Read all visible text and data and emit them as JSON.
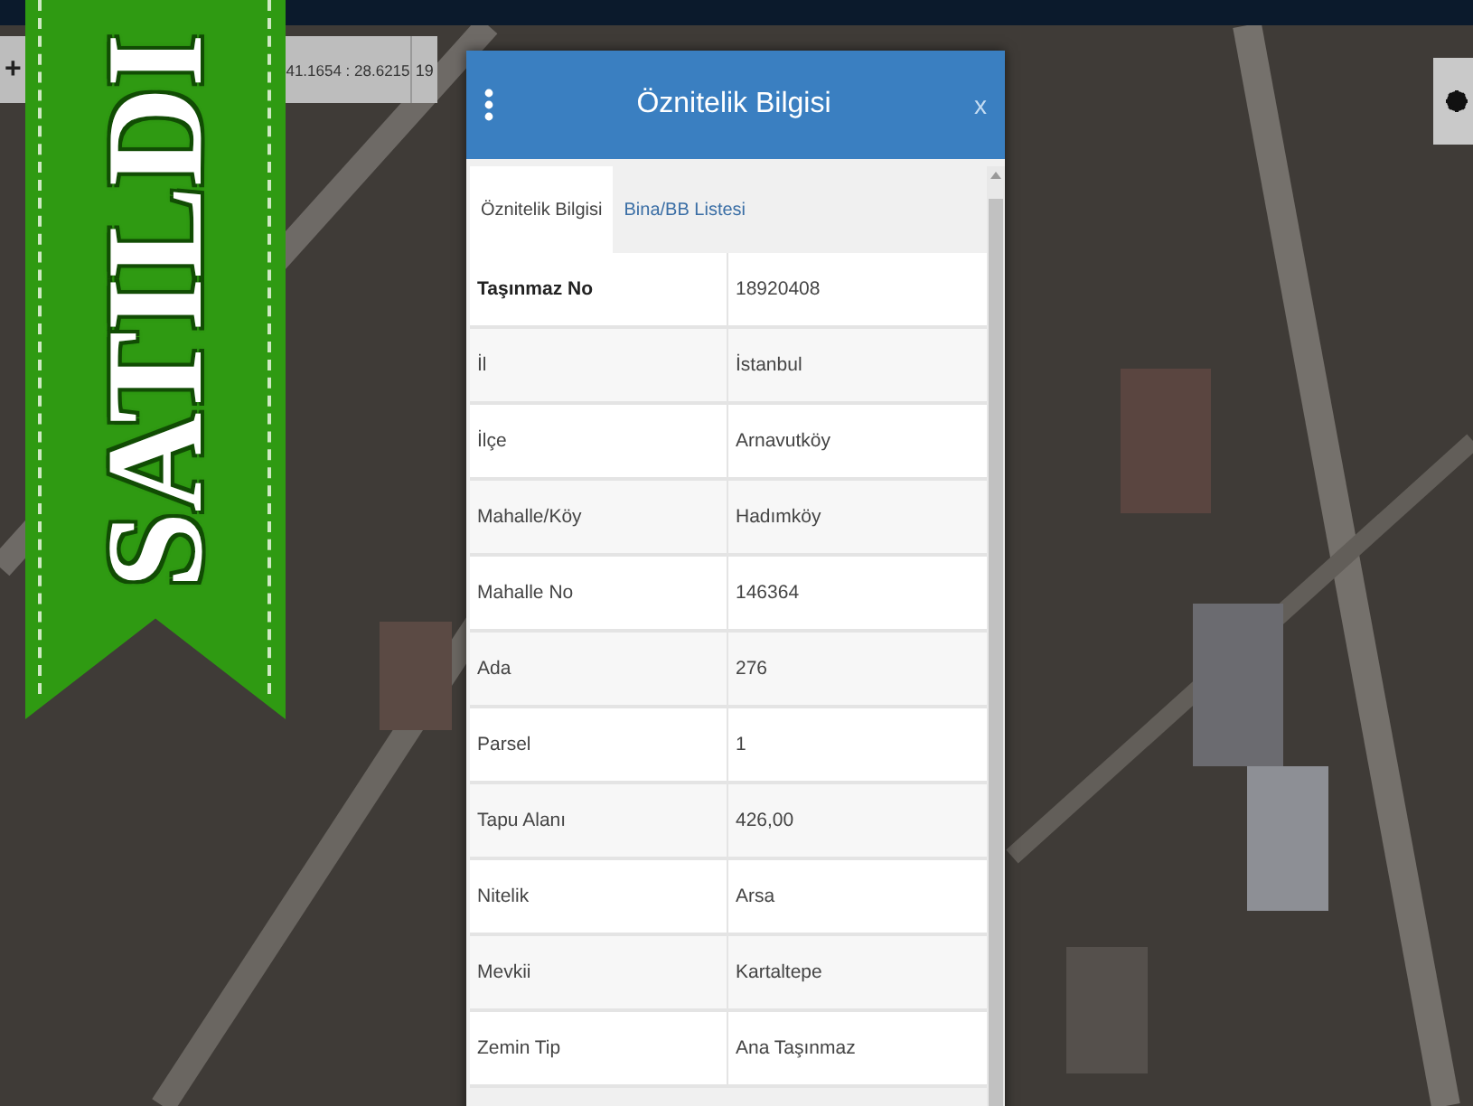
{
  "toolbar": {
    "zoom_in": "+",
    "coordinates": "41.1654 : 28.6215",
    "zoom_level": "19"
  },
  "sold_banner": {
    "text": "SATILDI"
  },
  "dialog": {
    "title": "Öznitelik Bilgisi",
    "close": "x",
    "tabs": [
      {
        "label": "Öznitelik Bilgisi",
        "selected": true
      },
      {
        "label": "Bina/BB Listesi",
        "selected": false
      }
    ],
    "rows": [
      {
        "label": "Taşınmaz No",
        "value": "18920408"
      },
      {
        "label": "İl",
        "value": "İstanbul"
      },
      {
        "label": "İlçe",
        "value": "Arnavutköy"
      },
      {
        "label": "Mahalle/Köy",
        "value": "Hadımköy"
      },
      {
        "label": "Mahalle No",
        "value": "146364"
      },
      {
        "label": "Ada",
        "value": "276"
      },
      {
        "label": "Parsel",
        "value": "1"
      },
      {
        "label": "Tapu Alanı",
        "value": "426,00"
      },
      {
        "label": "Nitelik",
        "value": "Arsa"
      },
      {
        "label": "Mevkii",
        "value": "Kartaltepe"
      },
      {
        "label": "Zemin Tip",
        "value": "Ana Taşınmaz"
      }
    ]
  }
}
